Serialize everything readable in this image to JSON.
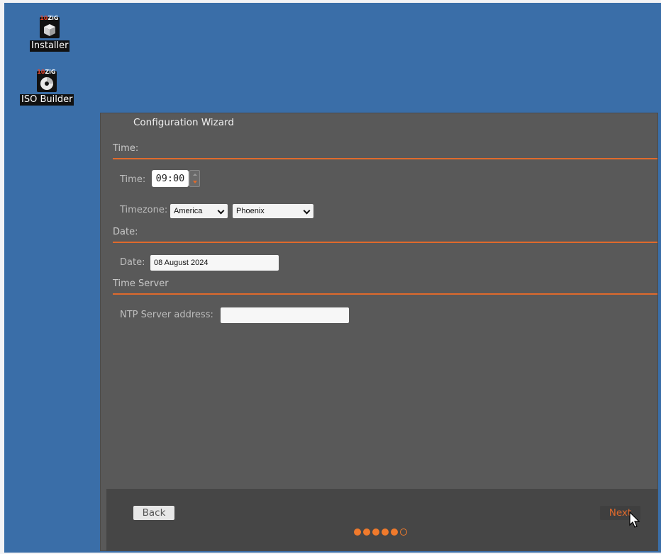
{
  "desktop": {
    "icons": [
      {
        "label": "Installer",
        "brand_a": "10",
        "brand_b": "ZiG"
      },
      {
        "label": "ISO Builder",
        "brand_a": "10",
        "brand_b": "ZiG"
      }
    ],
    "background_color": "#3a6ea8"
  },
  "wizard": {
    "title": "Configuration Wizard",
    "sections": {
      "time": "Time:",
      "date": "Date:",
      "time_server": "Time Server"
    },
    "time": {
      "label": "Time:",
      "value": "09:00"
    },
    "timezone": {
      "label": "Timezone:",
      "region": "America",
      "city": "Phoenix"
    },
    "date": {
      "label": "Date:",
      "value": "08 August 2024"
    },
    "ntp": {
      "label": "NTP Server address:",
      "value": ""
    },
    "footer": {
      "back_label": "Back",
      "next_label": "Next",
      "step_current": 5,
      "step_total": 6
    },
    "accent_color": "#e06a2c"
  }
}
